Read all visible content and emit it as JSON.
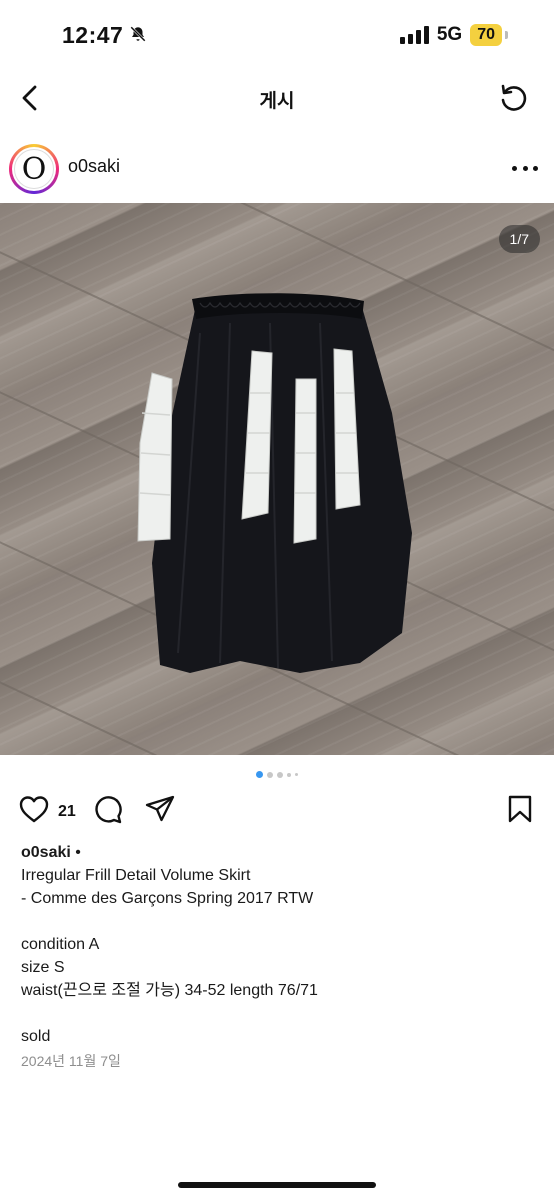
{
  "status": {
    "time": "12:47",
    "network": "5G",
    "battery": "70"
  },
  "nav": {
    "title": "게시"
  },
  "post": {
    "username": "o0saki",
    "avatar_letter": "O",
    "photo_counter": "1/7",
    "like_count": "21",
    "caption": {
      "user": "o0saki",
      "separator": " •",
      "lines": [
        "Irregular Frill Detail Volume Skirt",
        "- Comme des Garçons Spring 2017 RTW",
        "",
        "condition A",
        "size S",
        "waist(끈으로 조절 가능) 34-52 length 76/71",
        "",
        "sold"
      ],
      "date": "2024년 11월 7일"
    }
  },
  "icons": {
    "back": "chevron-left-icon",
    "refresh": "refresh-icon",
    "more": "more-dots-icon",
    "like": "heart-icon",
    "comment": "comment-icon",
    "share": "send-icon",
    "save": "bookmark-icon",
    "mute": "bell-slash-icon"
  },
  "colors": {
    "battery": "#f4d03f",
    "active_dot": "#3897f0",
    "inactive_dot": "#c7c7c7",
    "skirt": "#15161b",
    "frill": "#eef0ee"
  }
}
